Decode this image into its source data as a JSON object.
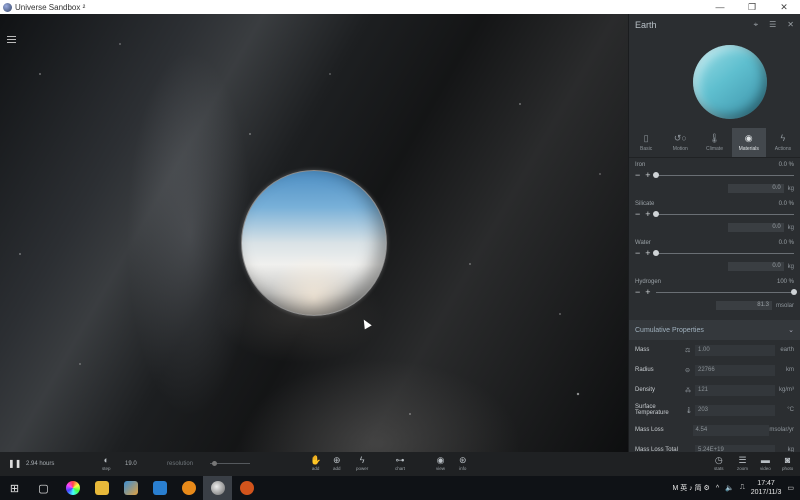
{
  "window": {
    "title": "Universe Sandbox ²",
    "controls": [
      "—",
      "❐",
      "✕"
    ]
  },
  "panel": {
    "object_name": "Earth",
    "tabs": [
      {
        "label": "Basic",
        "icon": "bookmark-icon"
      },
      {
        "label": "Motion",
        "icon": "orbit-icon"
      },
      {
        "label": "Climate",
        "icon": "thermometer-icon"
      },
      {
        "label": "Materials",
        "icon": "materials-icon",
        "active": true
      },
      {
        "label": "Actions",
        "icon": "lightning-icon"
      }
    ],
    "materials": [
      {
        "name": "Iron",
        "percent": "0.0 %",
        "amount": "0.0",
        "unit": "kg",
        "level": 0.0
      },
      {
        "name": "Silicate",
        "percent": "0.0 %",
        "amount": "0.0",
        "unit": "kg",
        "level": 0.0
      },
      {
        "name": "Water",
        "percent": "0.0 %",
        "amount": "0.0",
        "unit": "kg",
        "level": 0.0
      },
      {
        "name": "Hydrogen",
        "percent": "100 %",
        "amount": "81.3",
        "unit": "msolar",
        "level": 1.0
      }
    ],
    "cumulative": {
      "title": "Cumulative Properties",
      "rows": [
        {
          "name": "Mass",
          "value": "1.00",
          "unit": "earth"
        },
        {
          "name": "Radius",
          "value": "22766",
          "unit": "km"
        },
        {
          "name": "Density",
          "value": "121",
          "unit": "kg/m³"
        },
        {
          "name": "Surface Temperature",
          "value": "203",
          "unit": "°C"
        },
        {
          "name": "Mass Loss",
          "value": "4.54",
          "unit": "msolar/yr"
        },
        {
          "name": "Mass Loss Total",
          "value": "5.24E+19",
          "unit": "kg"
        }
      ]
    }
  },
  "bottombar": {
    "time": "2.94 hours",
    "step_label": "step",
    "step_value": "19.0",
    "resolution_label": "resolution",
    "tools": [
      {
        "label": "add",
        "icon": "hand-icon"
      },
      {
        "label": "add",
        "icon": "add-icon"
      },
      {
        "label": "power",
        "icon": "lightning-icon"
      },
      {
        "label": "chart",
        "icon": "chart-icon"
      },
      {
        "label": "view",
        "icon": "eye-icon"
      },
      {
        "label": "info",
        "icon": "info-icon"
      }
    ],
    "right_tools": [
      {
        "label": "stats",
        "icon": "clock-icon"
      },
      {
        "label": "zoom",
        "icon": "list-icon"
      },
      {
        "label": "video",
        "icon": "video-icon"
      },
      {
        "label": "photo",
        "icon": "camera-icon"
      }
    ]
  },
  "taskbar": {
    "tray_text": "M 英 ♪ 简 ⚙",
    "time": "17:47",
    "date": "2017/11/3"
  },
  "colors": {
    "panel_bg": "#2b2e31",
    "active_tab": "#43484d",
    "taskbar": "#0f1216"
  }
}
